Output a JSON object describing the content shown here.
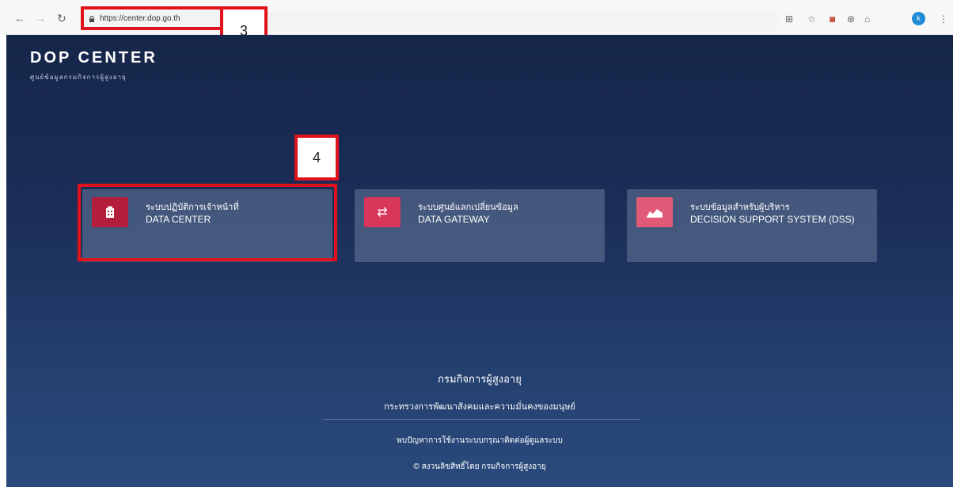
{
  "browser": {
    "url": "https://center.dop.go.th",
    "profile_initial": "k"
  },
  "annotations": {
    "step3": "3",
    "step4": "4"
  },
  "brand": {
    "title": "DOP CENTER",
    "subtitle": "ศูนย์ข้อมูลกรมกิจการผู้สูงอายุ"
  },
  "cards": [
    {
      "thai": "ระบบปฏิบัติการเจ้าหน้าที่",
      "english": "DATA CENTER",
      "icon": "building-icon",
      "color": "#b21e3b"
    },
    {
      "thai": "ระบบศูนย์แลกเปลี่ยนข้อมูล",
      "english": "DATA GATEWAY",
      "icon": "exchange-icon",
      "color": "#d8365a"
    },
    {
      "thai": "ระบบข้อมูลสำหรับผู้บริหาร",
      "english": "DECISION SUPPORT SYSTEM (DSS)",
      "icon": "area-chart-icon",
      "color": "#e05a78"
    }
  ],
  "footer": {
    "org": "กรมกิจการผู้สูงอายุ",
    "ministry": "กระทรวงการพัฒนาสังคมและความมั่นคงของมนุษย์",
    "contact": "พบปัญหาการใช้งานระบบกรุณาติดต่อผู้ดูแลระบบ",
    "copyright": "© สงวนลิขสิทธิ์โดย กรมกิจการผู้สูงอายุ"
  }
}
